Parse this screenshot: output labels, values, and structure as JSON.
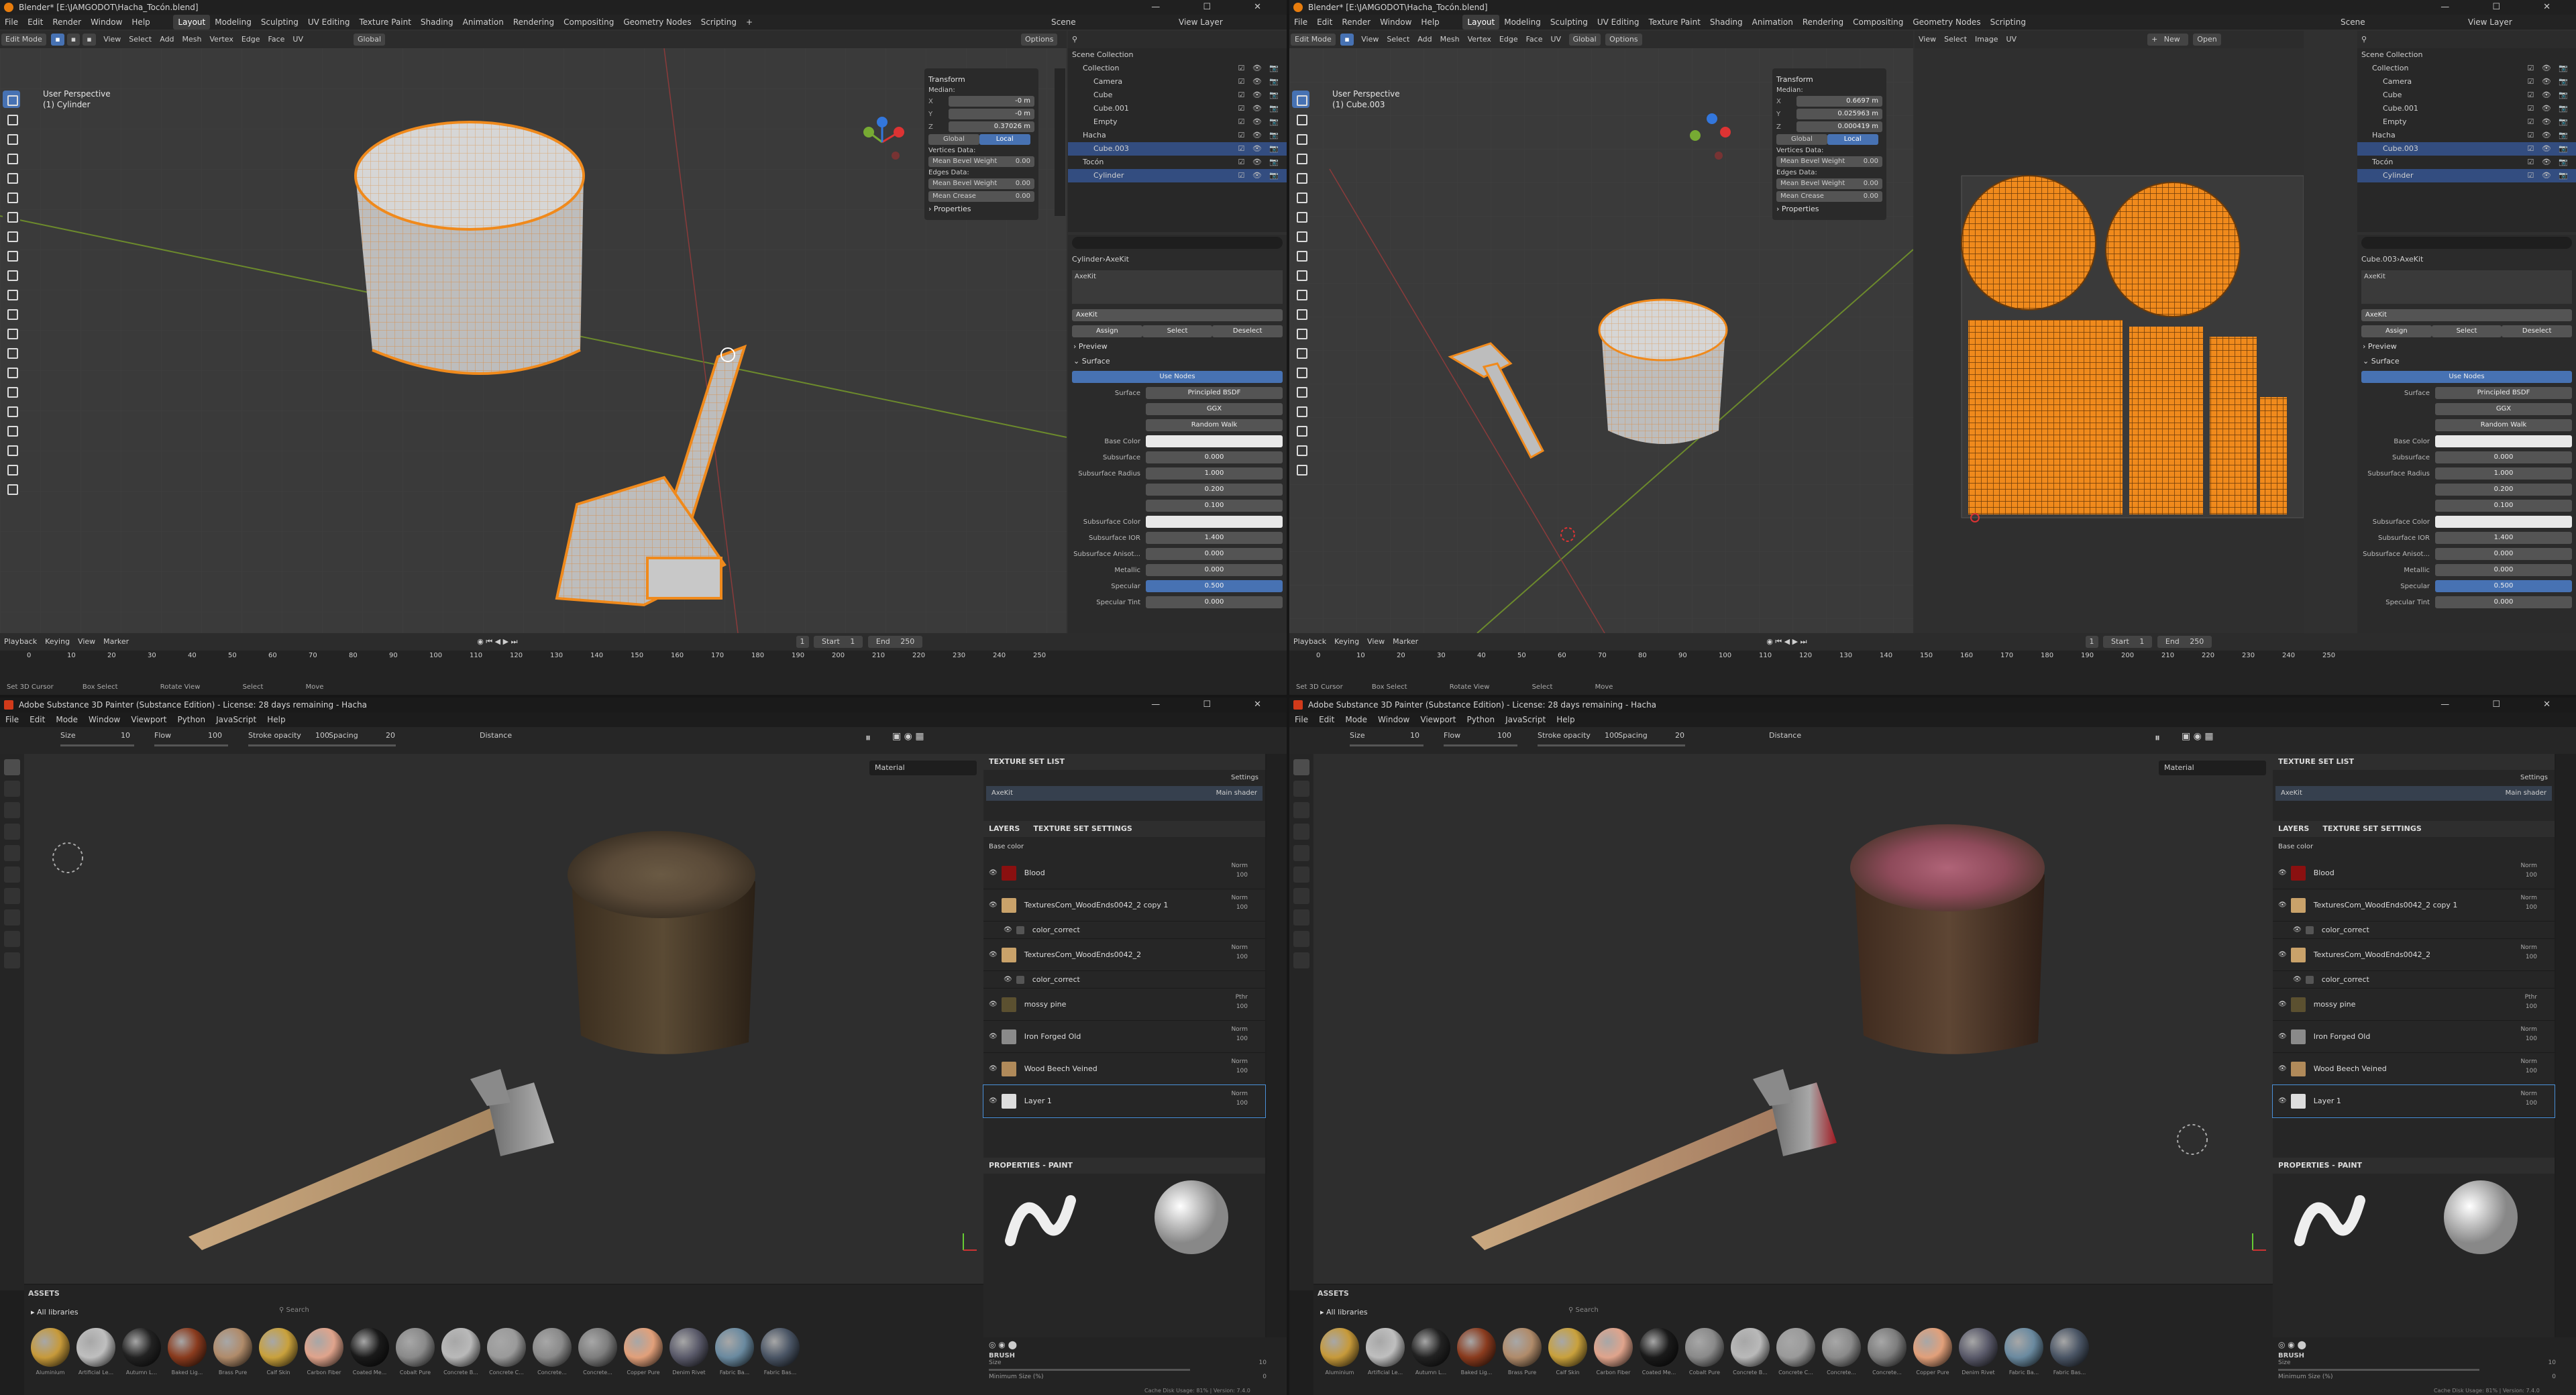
{
  "blender_left": {
    "title": "Blender* [E:\\JAMGODOT\\Hacha_Tocón.blend]",
    "menus": [
      "File",
      "Edit",
      "Render",
      "Window",
      "Help"
    ],
    "workspaces": [
      "Layout",
      "Modeling",
      "Sculpting",
      "UV Editing",
      "Texture Paint",
      "Shading",
      "Animation",
      "Rendering",
      "Compositing",
      "Geometry Nodes",
      "Scripting"
    ],
    "active_workspace": "Layout",
    "scene": "Scene",
    "view_layer": "View Layer",
    "mode": "Edit Mode",
    "header_menus": [
      "View",
      "Select",
      "Add",
      "Mesh",
      "Vertex",
      "Edge",
      "Face",
      "UV"
    ],
    "transform_orientation": "Global",
    "options": "Options",
    "viewport_label": "User Perspective",
    "object_label": "(1) Cylinder",
    "npanel": {
      "transform": "Transform",
      "median": "Median:",
      "x_label": "X",
      "x": "-0 m",
      "y_label": "Y",
      "y": "-0 m",
      "z_label": "Z",
      "z": "0.37026 m",
      "global": "Global",
      "local": "Local",
      "vertices_data": "Vertices Data:",
      "mean_bevel_weight_v": "Mean Bevel Weight",
      "mean_bevel_weight_v_val": "0.00",
      "edges_data": "Edges Data:",
      "mean_bevel_weight_e": "Mean Bevel Weight",
      "mean_bevel_weight_e_val": "0.00",
      "mean_crease": "Mean Crease",
      "mean_crease_val": "0.00",
      "properties": "Properties"
    },
    "outliner": [
      {
        "label": "Scene Collection",
        "indent": 0,
        "sel": false
      },
      {
        "label": "Collection",
        "indent": 1,
        "sel": false
      },
      {
        "label": "Camera",
        "indent": 2,
        "sel": false
      },
      {
        "label": "Cube",
        "indent": 2,
        "sel": false
      },
      {
        "label": "Cube.001",
        "indent": 2,
        "sel": false
      },
      {
        "label": "Empty",
        "indent": 2,
        "sel": false
      },
      {
        "label": "Hacha",
        "indent": 1,
        "sel": false
      },
      {
        "label": "Cube.003",
        "indent": 2,
        "sel": true
      },
      {
        "label": "Tocón",
        "indent": 1,
        "sel": false
      },
      {
        "label": "Cylinder",
        "indent": 2,
        "sel": true
      }
    ],
    "props": {
      "breadcrumb_object": "Cylinder",
      "breadcrumb_material": "AxeKit",
      "slot": "AxeKit",
      "material": "AxeKit",
      "assign": "Assign",
      "select": "Select",
      "deselect": "Deselect",
      "preview": "Preview",
      "surface_sec": "Surface",
      "use_nodes": "Use Nodes",
      "surface_label": "Surface",
      "surface": "Principled BSDF",
      "distribution": "GGX",
      "subsurface_method": "Random Walk",
      "rows": [
        {
          "label": "Base Color",
          "value": "",
          "style": "white"
        },
        {
          "label": "Subsurface",
          "value": "0.000",
          "style": ""
        },
        {
          "label": "Subsurface Radius",
          "value": "1.000",
          "style": ""
        },
        {
          "label": "",
          "value": "0.200",
          "style": ""
        },
        {
          "label": "",
          "value": "0.100",
          "style": ""
        },
        {
          "label": "Subsurface Color",
          "value": "",
          "style": "white"
        },
        {
          "label": "Subsurface IOR",
          "value": "1.400",
          "style": ""
        },
        {
          "label": "Subsurface Anisot...",
          "value": "0.000",
          "style": ""
        },
        {
          "label": "Metallic",
          "value": "0.000",
          "style": ""
        },
        {
          "label": "Specular",
          "value": "0.500",
          "style": "blue"
        },
        {
          "label": "Specular Tint",
          "value": "0.000",
          "style": ""
        }
      ]
    },
    "timeline": {
      "menus": [
        "Playback",
        "Keying",
        "View",
        "Marker"
      ],
      "frame": "1",
      "start_label": "Start",
      "start": "1",
      "end_label": "End",
      "end": "250",
      "ticks": [
        "0",
        "10",
        "20",
        "30",
        "40",
        "50",
        "60",
        "70",
        "80",
        "90",
        "100",
        "110",
        "120",
        "130",
        "140",
        "150",
        "160",
        "170",
        "180",
        "190",
        "200",
        "210",
        "220",
        "230",
        "240",
        "250"
      ]
    },
    "status": [
      "Set 3D Cursor",
      "Box Select",
      "Rotate View",
      "Select",
      "Move"
    ]
  },
  "blender_right": {
    "title": "Blender* [E:\\JAMGODOT\\Hacha_Tocón.blend]",
    "object_label": "(1) Cube.003",
    "uv_menus": [
      "View",
      "Select",
      "Image",
      "UV"
    ],
    "uv_new": "New",
    "uv_open": "Open",
    "npanel": {
      "x": "0.6697 m",
      "y": "0.025963 m",
      "z": "0.000419 m"
    },
    "breadcrumb_object": "Cube.003",
    "outliner_sel": "Cylinder"
  },
  "substance_left": {
    "title": "Adobe Substance 3D Painter (Substance Edition) - License: 28 days remaining - Hacha",
    "menus": [
      "File",
      "Edit",
      "Mode",
      "Window",
      "Viewport",
      "Python",
      "JavaScript",
      "Help"
    ],
    "tool": {
      "size_label": "Size",
      "size": "10",
      "flow_label": "Flow",
      "flow": "100",
      "stroke_opacity_label": "Stroke opacity",
      "stroke_opacity": "100",
      "spacing_label": "Spacing",
      "spacing": "20",
      "distance_label": "Distance"
    },
    "viewport_mode": "Material",
    "texture_set_list": "TEXTURE SET LIST",
    "settings": "Settings",
    "texture_set": "AxeKit",
    "main_shader": "Main shader",
    "tabs": [
      "LAYERS",
      "TEXTURE SET SETTINGS"
    ],
    "channel": "Base color",
    "layers": [
      {
        "name": "Blood",
        "blend": "Norm",
        "opacity": "100",
        "sub": false,
        "color": "#8a1010"
      },
      {
        "name": "TexturesCom_WoodEnds0042_2 copy 1",
        "blend": "Norm",
        "opacity": "100",
        "sub": false,
        "color": "#c9a26a"
      },
      {
        "name": "color_correct",
        "blend": "",
        "opacity": "",
        "sub": true,
        "color": "#555555"
      },
      {
        "name": "TexturesCom_WoodEnds0042_2",
        "blend": "Norm",
        "opacity": "100",
        "sub": false,
        "color": "#c9a26a"
      },
      {
        "name": "color_correct",
        "blend": "",
        "opacity": "",
        "sub": true,
        "color": "#555555"
      },
      {
        "name": "mossy pine",
        "blend": "Pthr",
        "opacity": "100",
        "sub": false,
        "color": "#5b5030"
      },
      {
        "name": "Iron Forged Old",
        "blend": "Norm",
        "opacity": "100",
        "sub": false,
        "color": "#8a8a8a"
      },
      {
        "name": "Wood Beech Veined",
        "blend": "Norm",
        "opacity": "100",
        "sub": false,
        "color": "#b08a5a"
      },
      {
        "name": "Layer 1",
        "blend": "Norm",
        "opacity": "100",
        "sub": false,
        "color": "#dddddd"
      }
    ],
    "properties_paint": "PROPERTIES - PAINT",
    "assets_title": "ASSETS",
    "all_libraries": "All libraries",
    "search_placeholder": "Search",
    "asset_names": [
      "Aluminium",
      "Artificial Le...",
      "Autumn L...",
      "Baked Lig...",
      "Brass Pure",
      "Calf Skin",
      "Carbon Fiber",
      "Coated Me...",
      "Cobalt Pure",
      "Concrete B...",
      "Concrete C...",
      "Concrete...",
      "Concrete...",
      "Copper Pure",
      "Denim Rivet",
      "Fabric Ba...",
      "Fabric Bas..."
    ],
    "asset_colors": [
      "#c79a3a",
      "#bfbfbf",
      "#222222",
      "#8a3b1e",
      "#b08b6a",
      "#c9a13c",
      "#e0a48c",
      "#1a1a1a",
      "#8a8a8a",
      "#b9b9b9",
      "#9a9a9a",
      "#8a8a8a",
      "#7d7d7d",
      "#e2a07a",
      "#5a5a6a",
      "#6a8aa0",
      "#4a5565"
    ],
    "brush_title": "BRUSH",
    "brush_size_label": "Size",
    "brush_size": "10",
    "min_size_label": "Minimum Size (%)",
    "min_size": "0",
    "cache": "Cache Disk Usage:  81% | Version: 7.4.0"
  },
  "substance_right": {
    "title": "Adobe Substance 3D Painter (Substance Edition) - License: 28 days remaining - Hacha"
  }
}
